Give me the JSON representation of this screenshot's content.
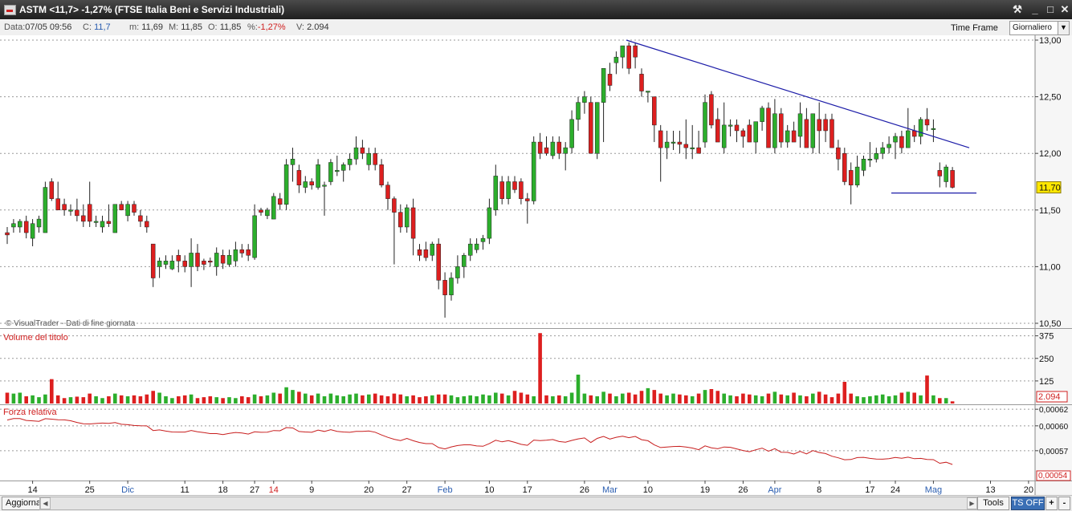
{
  "window": {
    "title": "ASTM <11,7> -1,27%  (FTSE Italia Beni e Servizi Industriali)",
    "buttons": [
      "⚒",
      "_",
      "□",
      "✕"
    ]
  },
  "infobar": {
    "data_label": "Data:",
    "data_value": "07/05 09:56",
    "c_label": "C:",
    "c_value": "11,7",
    "m_label": "m:",
    "m_value": "11,69",
    "M_label": "M:",
    "M_value": "11,85",
    "o_label": "O:",
    "o_value": "11,85",
    "pct_label": "%:",
    "pct_value": "-1,27%",
    "v_label": "V:",
    "v_value": "2.094",
    "timeframe_label": "Time Frame",
    "timeframe_value": "Giornaliero"
  },
  "bottombar": {
    "aggiorna": "Aggiorna",
    "tools": "Tools",
    "tsoff": "TS OFF",
    "zoom_in": "+",
    "zoom_out": "-"
  },
  "colors": {
    "up": "#2cae2c",
    "down": "#dd1f1f",
    "trend": "#1c1ca8",
    "rs": "#c81e1e",
    "grid": "#9a9a9a"
  },
  "chart_data": [
    {
      "type": "candlestick",
      "watermark": "© VisualTrader - Dati di fine giornata",
      "ylim": [
        10.5,
        13.0
      ],
      "yticks": [
        "13,00",
        "12,50",
        "12,00",
        "11,50",
        "11,00",
        "10,50"
      ],
      "last_label": "11,70",
      "x_labels": [
        {
          "label": "14",
          "i": 4,
          "highlight": ""
        },
        {
          "label": "25",
          "i": 13,
          "highlight": ""
        },
        {
          "label": "Dic",
          "i": 19,
          "highlight": "blue"
        },
        {
          "label": "11",
          "i": 28,
          "highlight": ""
        },
        {
          "label": "18",
          "i": 34,
          "highlight": ""
        },
        {
          "label": "27",
          "i": 39,
          "highlight": ""
        },
        {
          "label": "14",
          "i": 42,
          "highlight": "red"
        },
        {
          "label": "9",
          "i": 48,
          "highlight": ""
        },
        {
          "label": "20",
          "i": 57,
          "highlight": ""
        },
        {
          "label": "27",
          "i": 63,
          "highlight": ""
        },
        {
          "label": "Feb",
          "i": 69,
          "highlight": "blue"
        },
        {
          "label": "10",
          "i": 76,
          "highlight": ""
        },
        {
          "label": "17",
          "i": 82,
          "highlight": ""
        },
        {
          "label": "26",
          "i": 91,
          "highlight": ""
        },
        {
          "label": "Mar",
          "i": 95,
          "highlight": "blue"
        },
        {
          "label": "10",
          "i": 101,
          "highlight": ""
        },
        {
          "label": "19",
          "i": 110,
          "highlight": ""
        },
        {
          "label": "26",
          "i": 116,
          "highlight": ""
        },
        {
          "label": "Apr",
          "i": 121,
          "highlight": "blue"
        },
        {
          "label": "8",
          "i": 128,
          "highlight": ""
        },
        {
          "label": "17",
          "i": 136,
          "highlight": ""
        },
        {
          "label": "24",
          "i": 140,
          "highlight": ""
        },
        {
          "label": "Mag",
          "i": 146,
          "highlight": "blue"
        },
        {
          "label": "13",
          "i": 155,
          "highlight": ""
        },
        {
          "label": "20",
          "i": 161,
          "highlight": ""
        }
      ],
      "candles": [
        [
          11.3,
          11.35,
          11.2,
          11.28
        ],
        [
          11.35,
          11.42,
          11.3,
          11.38
        ],
        [
          11.35,
          11.42,
          11.3,
          11.4
        ],
        [
          11.4,
          11.45,
          11.25,
          11.3
        ],
        [
          11.25,
          11.42,
          11.18,
          11.38
        ],
        [
          11.35,
          11.45,
          11.3,
          11.42
        ],
        [
          11.3,
          11.75,
          11.3,
          11.7
        ],
        [
          11.75,
          11.78,
          11.58,
          11.6
        ],
        [
          11.6,
          11.75,
          11.5,
          11.5
        ],
        [
          11.55,
          11.6,
          11.45,
          11.5
        ],
        [
          11.5,
          11.55,
          11.45,
          11.5
        ],
        [
          11.5,
          11.6,
          11.4,
          11.45
        ],
        [
          11.45,
          11.55,
          11.35,
          11.4
        ],
        [
          11.55,
          11.75,
          11.35,
          11.4
        ],
        [
          11.4,
          11.45,
          11.35,
          11.4
        ],
        [
          11.35,
          11.45,
          11.3,
          11.4
        ],
        [
          11.4,
          11.55,
          11.35,
          11.38
        ],
        [
          11.3,
          11.55,
          11.3,
          11.55
        ],
        [
          11.55,
          11.58,
          11.5,
          11.5
        ],
        [
          11.45,
          11.58,
          11.4,
          11.55
        ],
        [
          11.55,
          11.58,
          11.45,
          11.48
        ],
        [
          11.45,
          11.5,
          11.35,
          11.4
        ],
        [
          11.4,
          11.45,
          11.3,
          11.35
        ],
        [
          11.2,
          11.2,
          10.82,
          10.9
        ],
        [
          11.0,
          11.08,
          10.9,
          11.05
        ],
        [
          11.02,
          11.1,
          10.98,
          11.05
        ],
        [
          10.98,
          11.1,
          10.97,
          11.05
        ],
        [
          11.1,
          11.15,
          10.95,
          11.05
        ],
        [
          11.05,
          11.1,
          10.95,
          11.0
        ],
        [
          11.0,
          11.25,
          10.82,
          11.12
        ],
        [
          11.12,
          11.2,
          10.96,
          11.0
        ],
        [
          11.05,
          11.07,
          10.97,
          11.02
        ],
        [
          11.05,
          11.08,
          11.0,
          11.04
        ],
        [
          11.0,
          11.17,
          10.92,
          11.12
        ],
        [
          11.1,
          11.15,
          10.98,
          11.03
        ],
        [
          11.02,
          11.15,
          11.0,
          11.1
        ],
        [
          11.05,
          11.22,
          11.0,
          11.15
        ],
        [
          11.15,
          11.2,
          11.08,
          11.12
        ],
        [
          11.15,
          11.2,
          11.05,
          11.1
        ],
        [
          11.08,
          11.55,
          11.06,
          11.45
        ],
        [
          11.5,
          11.52,
          11.45,
          11.48
        ],
        [
          11.45,
          11.52,
          11.42,
          11.5
        ],
        [
          11.42,
          11.65,
          11.42,
          11.62
        ],
        [
          11.6,
          11.65,
          11.5,
          11.55
        ],
        [
          11.55,
          11.95,
          11.5,
          11.9
        ],
        [
          11.9,
          12.05,
          11.75,
          11.95
        ],
        [
          11.85,
          11.9,
          11.65,
          11.72
        ],
        [
          11.7,
          11.8,
          11.65,
          11.75
        ],
        [
          11.75,
          11.78,
          11.68,
          11.72
        ],
        [
          11.7,
          11.95,
          11.68,
          11.9
        ],
        [
          11.72,
          11.75,
          11.45,
          11.72
        ],
        [
          11.75,
          11.95,
          11.72,
          11.92
        ],
        [
          11.85,
          11.98,
          11.8,
          11.85
        ],
        [
          11.85,
          11.92,
          11.75,
          11.9
        ],
        [
          11.9,
          12.0,
          11.85,
          11.95
        ],
        [
          11.95,
          12.15,
          11.9,
          12.05
        ],
        [
          12.05,
          12.12,
          11.95,
          12.0
        ],
        [
          11.9,
          12.05,
          11.85,
          12.0
        ],
        [
          12.0,
          12.05,
          11.85,
          11.9
        ],
        [
          11.9,
          11.95,
          11.7,
          11.72
        ],
        [
          11.72,
          11.75,
          11.5,
          11.6
        ],
        [
          11.6,
          11.62,
          11.02,
          11.48
        ],
        [
          11.48,
          11.55,
          11.3,
          11.35
        ],
        [
          11.35,
          11.55,
          11.3,
          11.52
        ],
        [
          11.52,
          11.6,
          11.1,
          11.25
        ],
        [
          11.15,
          11.2,
          11.05,
          11.1
        ],
        [
          11.15,
          11.22,
          11.05,
          11.08
        ],
        [
          11.1,
          11.22,
          11.05,
          11.2
        ],
        [
          11.2,
          11.25,
          10.8,
          10.88
        ],
        [
          10.88,
          10.95,
          10.55,
          10.75
        ],
        [
          10.75,
          10.95,
          10.7,
          10.9
        ],
        [
          10.9,
          11.1,
          10.85,
          11.0
        ],
        [
          11.0,
          11.12,
          10.9,
          11.1
        ],
        [
          11.1,
          11.25,
          11.05,
          11.2
        ],
        [
          11.15,
          11.25,
          11.12,
          11.2
        ],
        [
          11.22,
          11.28,
          11.15,
          11.25
        ],
        [
          11.25,
          11.6,
          11.2,
          11.52
        ],
        [
          11.5,
          11.9,
          11.45,
          11.8
        ],
        [
          11.75,
          11.8,
          11.55,
          11.6
        ],
        [
          11.6,
          11.8,
          11.55,
          11.75
        ],
        [
          11.75,
          11.8,
          11.65,
          11.68
        ],
        [
          11.75,
          11.78,
          11.55,
          11.6
        ],
        [
          11.6,
          11.65,
          11.38,
          11.58
        ],
        [
          11.58,
          12.15,
          11.55,
          12.1
        ],
        [
          12.1,
          12.18,
          11.95,
          12.0
        ],
        [
          12.05,
          12.15,
          11.98,
          12.0
        ],
        [
          11.98,
          12.15,
          11.95,
          12.1
        ],
        [
          12.1,
          12.15,
          11.95,
          12.0
        ],
        [
          12.0,
          12.1,
          11.85,
          12.05
        ],
        [
          12.05,
          12.38,
          12.0,
          12.3
        ],
        [
          12.3,
          12.5,
          12.2,
          12.45
        ],
        [
          12.45,
          12.55,
          12.35,
          12.5
        ],
        [
          12.45,
          12.5,
          12.0,
          12.0
        ],
        [
          12.0,
          12.45,
          11.95,
          12.45
        ],
        [
          12.45,
          12.75,
          12.1,
          12.75
        ],
        [
          12.7,
          12.8,
          12.55,
          12.6
        ],
        [
          12.8,
          12.9,
          12.7,
          12.85
        ],
        [
          12.85,
          12.95,
          12.75,
          12.95
        ],
        [
          12.95,
          12.98,
          12.7,
          12.75
        ],
        [
          12.95,
          12.98,
          12.75,
          12.85
        ],
        [
          12.7,
          12.75,
          12.5,
          12.55
        ],
        [
          12.55,
          12.55,
          12.45,
          12.55
        ],
        [
          12.5,
          12.5,
          12.1,
          12.25
        ],
        [
          12.2,
          12.25,
          11.75,
          12.05
        ],
        [
          12.05,
          12.2,
          11.95,
          12.1
        ],
        [
          12.1,
          12.2,
          12.03,
          12.1
        ],
        [
          12.1,
          12.2,
          12.0,
          12.08
        ],
        [
          12.08,
          12.3,
          11.95,
          12.05
        ],
        [
          12.05,
          12.25,
          11.95,
          12.05
        ],
        [
          12.05,
          12.2,
          12.0,
          12.0
        ],
        [
          12.1,
          12.52,
          12.05,
          12.45
        ],
        [
          12.52,
          12.55,
          12.22,
          12.25
        ],
        [
          12.3,
          12.4,
          12.15,
          12.1
        ],
        [
          12.05,
          12.45,
          12.0,
          12.25
        ],
        [
          12.25,
          12.3,
          12.15,
          12.25
        ],
        [
          12.25,
          12.3,
          12.1,
          12.2
        ],
        [
          12.2,
          12.22,
          12.05,
          12.15
        ],
        [
          12.25,
          12.3,
          12.1,
          12.1
        ],
        [
          12.1,
          12.25,
          12.0,
          12.28
        ],
        [
          12.28,
          12.42,
          12.2,
          12.4
        ],
        [
          12.4,
          12.45,
          12.15,
          12.05
        ],
        [
          12.05,
          12.48,
          12.0,
          12.35
        ],
        [
          12.35,
          12.4,
          12.05,
          12.1
        ],
        [
          12.1,
          12.25,
          12.05,
          12.2
        ],
        [
          12.2,
          12.28,
          12.15,
          12.1
        ],
        [
          12.15,
          12.45,
          12.05,
          12.35
        ],
        [
          12.3,
          12.4,
          12.2,
          12.05
        ],
        [
          12.05,
          12.35,
          12.0,
          12.35
        ],
        [
          12.3,
          12.45,
          12.0,
          12.2
        ],
        [
          12.3,
          12.35,
          12.1,
          12.2
        ],
        [
          12.3,
          12.35,
          12.1,
          12.05
        ],
        [
          12.05,
          12.12,
          11.85,
          11.95
        ],
        [
          12.0,
          12.05,
          11.72,
          11.75
        ],
        [
          11.85,
          11.92,
          11.55,
          11.72
        ],
        [
          11.72,
          11.98,
          11.7,
          11.88
        ],
        [
          11.85,
          11.98,
          11.8,
          11.95
        ],
        [
          11.95,
          12.1,
          11.88,
          11.95
        ],
        [
          11.95,
          12.05,
          11.92,
          12.0
        ],
        [
          12.0,
          12.1,
          11.95,
          12.05
        ],
        [
          12.05,
          12.15,
          12.0,
          12.08
        ],
        [
          12.1,
          12.18,
          11.95,
          12.15
        ],
        [
          12.15,
          12.2,
          12.0,
          12.05
        ],
        [
          12.05,
          12.4,
          12.05,
          12.2
        ],
        [
          12.2,
          12.25,
          12.1,
          12.15
        ],
        [
          12.15,
          12.32,
          12.08,
          12.3
        ],
        [
          12.3,
          12.4,
          12.2,
          12.25
        ],
        [
          12.22,
          12.3,
          12.1,
          12.22
        ],
        [
          11.85,
          11.92,
          11.7,
          11.8
        ],
        [
          11.75,
          11.9,
          11.7,
          11.88
        ],
        [
          11.85,
          11.88,
          11.69,
          11.7
        ]
      ],
      "trendline": {
        "from": [
          110,
          13.0
        ],
        "to": [
          197,
          12.05
        ]
      },
      "support": {
        "y": 11.65,
        "from_i": 157,
        "to_i": 172
      }
    },
    {
      "type": "bar",
      "title": "Volume del titolo",
      "ylim": [
        0,
        400
      ],
      "yticks": [
        "375",
        "250",
        "125"
      ],
      "last_label": "2.094",
      "values": [
        60,
        55,
        60,
        40,
        45,
        35,
        50,
        135,
        45,
        30,
        35,
        38,
        35,
        55,
        40,
        30,
        40,
        55,
        45,
        40,
        45,
        40,
        50,
        70,
        60,
        40,
        30,
        40,
        45,
        50,
        30,
        35,
        40,
        35,
        30,
        35,
        30,
        40,
        35,
        50,
        40,
        45,
        60,
        55,
        90,
        75,
        65,
        55,
        45,
        55,
        40,
        55,
        45,
        40,
        50,
        55,
        45,
        50,
        55,
        45,
        40,
        55,
        50,
        40,
        45,
        35,
        40,
        45,
        50,
        50,
        45,
        35,
        40,
        45,
        40,
        50,
        45,
        60,
        55,
        45,
        70,
        60,
        50,
        40,
        390,
        45,
        40,
        45,
        40,
        60,
        160,
        55,
        45,
        40,
        65,
        55,
        40,
        55,
        60,
        50,
        70,
        85,
        75,
        55,
        45,
        55,
        50,
        45,
        40,
        55,
        75,
        80,
        70,
        55,
        45,
        40,
        55,
        50,
        45,
        40,
        55,
        65,
        50,
        45,
        60,
        45,
        40,
        55,
        65,
        50,
        35,
        55,
        120,
        55,
        40,
        35,
        40,
        45,
        50,
        40,
        45,
        60,
        65,
        60,
        45,
        155,
        45,
        30,
        30,
        12
      ]
    },
    {
      "type": "line",
      "title": "Forza relativa",
      "ylim": [
        0.000535,
        0.000625
      ],
      "yticks": [
        "0,00062",
        "0,00060",
        "0,00057"
      ],
      "last_label": "0,00054"
    }
  ]
}
